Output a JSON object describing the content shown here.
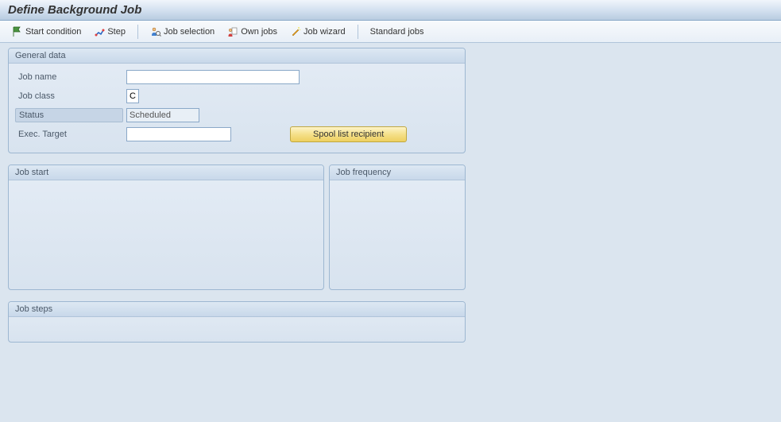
{
  "title": "Define Background Job",
  "toolbar": {
    "start_condition": "Start condition",
    "step": "Step",
    "job_selection": "Job selection",
    "own_jobs": "Own jobs",
    "job_wizard": "Job wizard",
    "standard_jobs": "Standard jobs"
  },
  "general_data": {
    "title": "General data",
    "job_name_label": "Job name",
    "job_name_value": "",
    "job_class_label": "Job class",
    "job_class_value": "C",
    "status_label": "Status",
    "status_value": "Scheduled",
    "exec_target_label": "Exec. Target",
    "exec_target_value": "",
    "spool_btn": "Spool list recipient"
  },
  "job_start": {
    "title": "Job start"
  },
  "job_frequency": {
    "title": "Job frequency"
  },
  "job_steps": {
    "title": "Job steps"
  }
}
